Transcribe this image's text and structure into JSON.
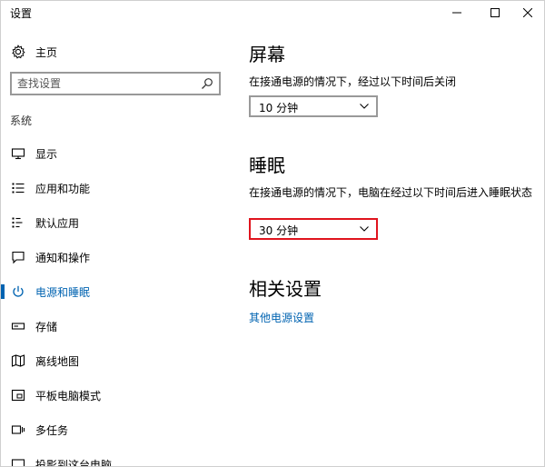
{
  "window": {
    "title": "设置"
  },
  "sidebar": {
    "home_label": "主页",
    "search": {
      "placeholder": "查找设置",
      "value": ""
    },
    "section_label": "系统",
    "items": [
      {
        "label": "显示",
        "icon": "monitor-icon"
      },
      {
        "label": "应用和功能",
        "icon": "list-icon"
      },
      {
        "label": "默认应用",
        "icon": "default-apps-icon"
      },
      {
        "label": "通知和操作",
        "icon": "message-icon"
      },
      {
        "label": "电源和睡眠",
        "icon": "power-icon",
        "active": true
      },
      {
        "label": "存储",
        "icon": "storage-icon"
      },
      {
        "label": "离线地图",
        "icon": "map-icon"
      },
      {
        "label": "平板电脑模式",
        "icon": "tablet-icon"
      },
      {
        "label": "多任务",
        "icon": "multitask-icon"
      },
      {
        "label": "投影到这台电脑",
        "icon": "project-icon"
      }
    ]
  },
  "content": {
    "screen": {
      "heading": "屏幕",
      "description": "在接通电源的情况下，经过以下时间后关闭",
      "selected": "10 分钟"
    },
    "sleep": {
      "heading": "睡眠",
      "description": "在接通电源的情况下，电脑在经过以下时间后进入睡眠状态",
      "selected": "30 分钟"
    },
    "related": {
      "heading": "相关设置",
      "link": "其他电源设置"
    }
  },
  "colors": {
    "accent": "#0063b1",
    "highlight": "#e0141e"
  }
}
